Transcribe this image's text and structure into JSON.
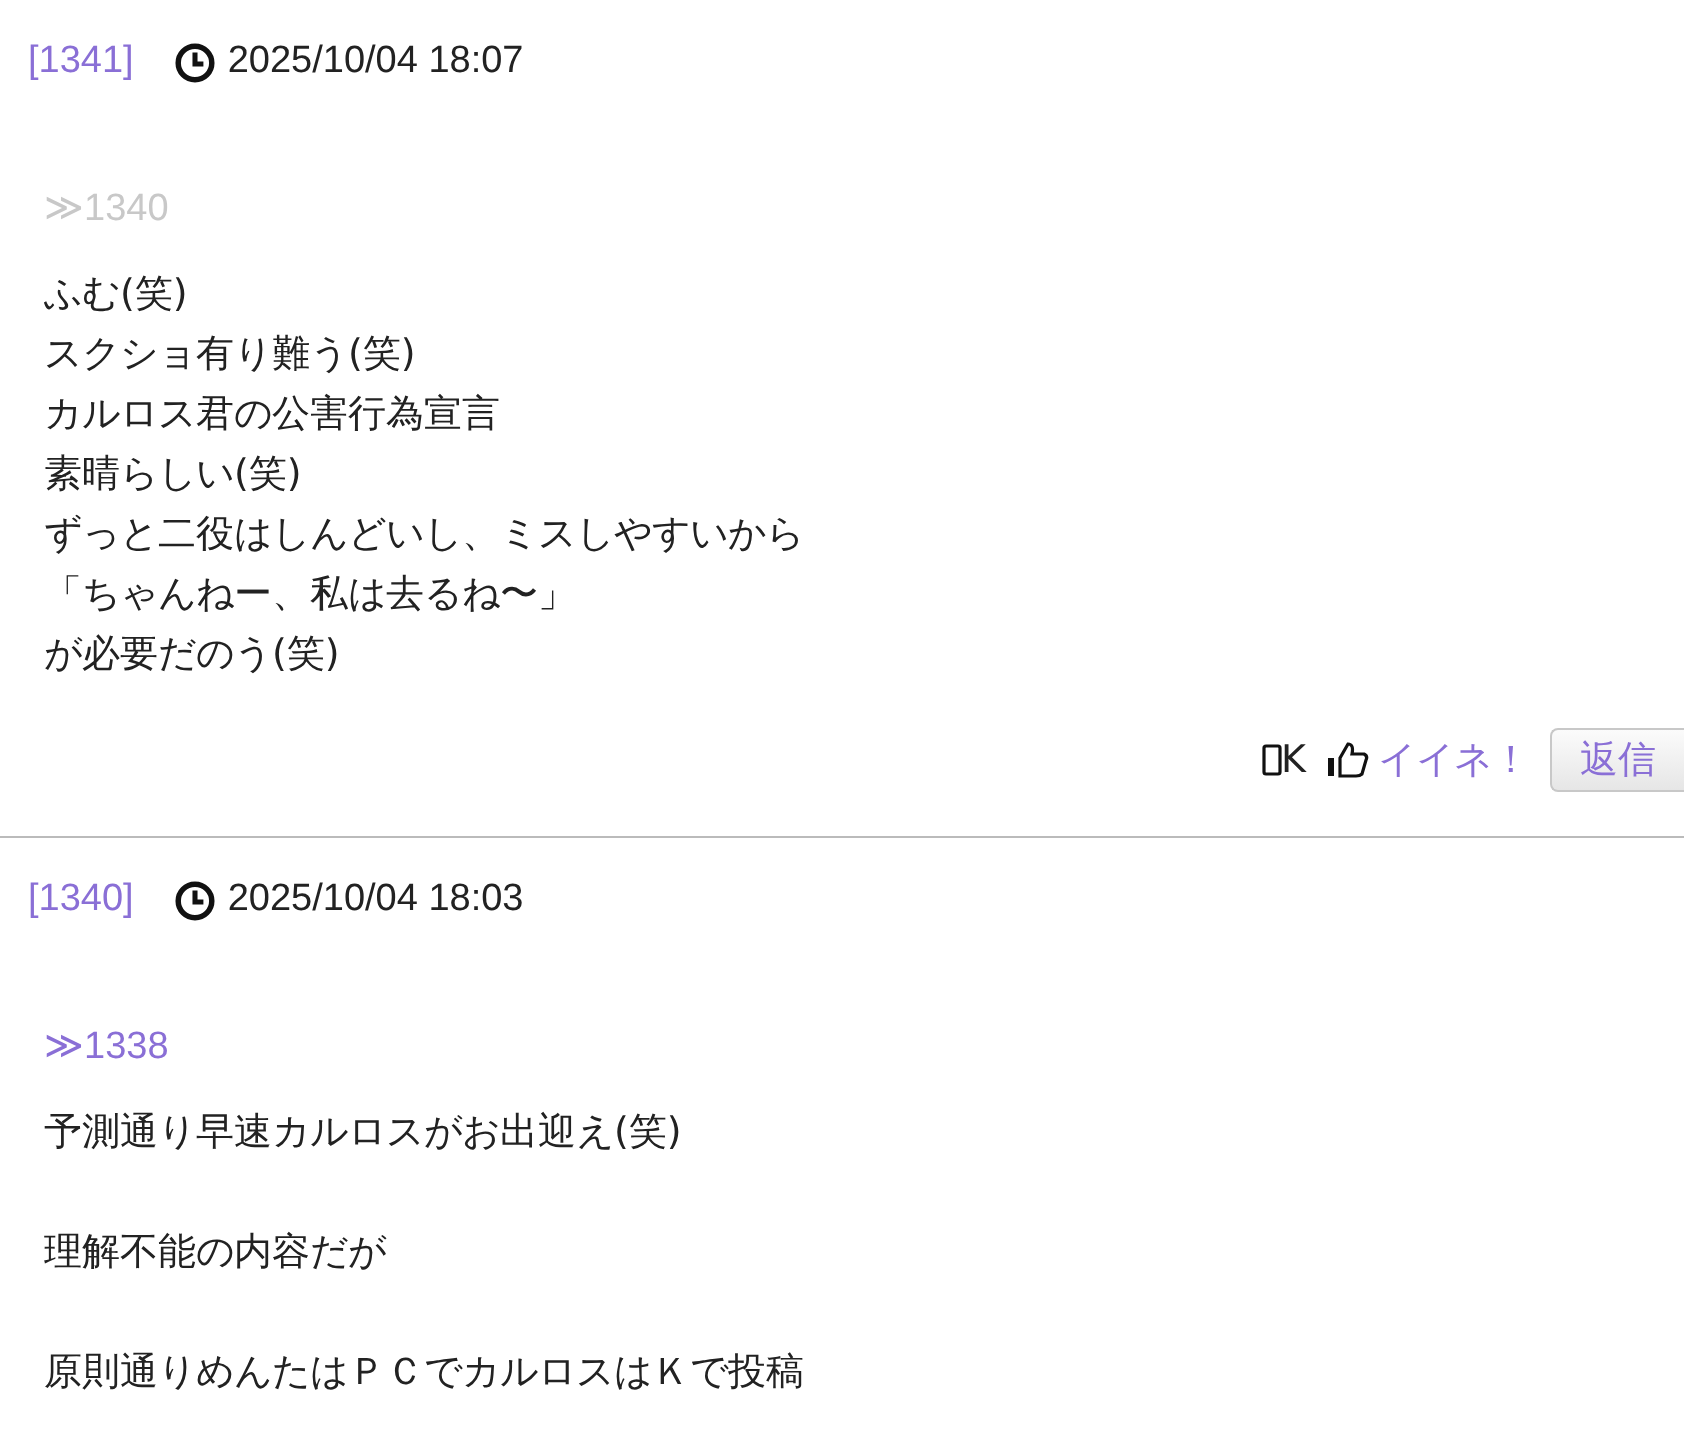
{
  "posts": [
    {
      "number": "[1341]",
      "datetime": "2025/10/04 18:07",
      "reply_to": {
        "text": "≫1340",
        "visited": true
      },
      "paragraphs": [
        [
          "ふむ(笑)",
          "スクショ有り難う(笑)",
          "カルロス君の公害行為宣言",
          "素晴らしい(笑)",
          "ずっと二役はしんどいし、ミスしやすいから",
          "「ちゃんねー、私は去るね〜」",
          "が必要だのう(笑)"
        ]
      ],
      "device": "K",
      "like_label": "イイネ！",
      "reply_button": "返信"
    },
    {
      "number": "[1340]",
      "datetime": "2025/10/04 18:03",
      "reply_to": {
        "text": "≫1338",
        "visited": false
      },
      "paragraphs": [
        [
          "予測通り早速カルロスがお出迎え(笑)"
        ],
        [
          "理解不能の内容だが"
        ],
        [
          "原則通りめんたはＰＣでカルロスはＫで投稿"
        ]
      ]
    }
  ]
}
